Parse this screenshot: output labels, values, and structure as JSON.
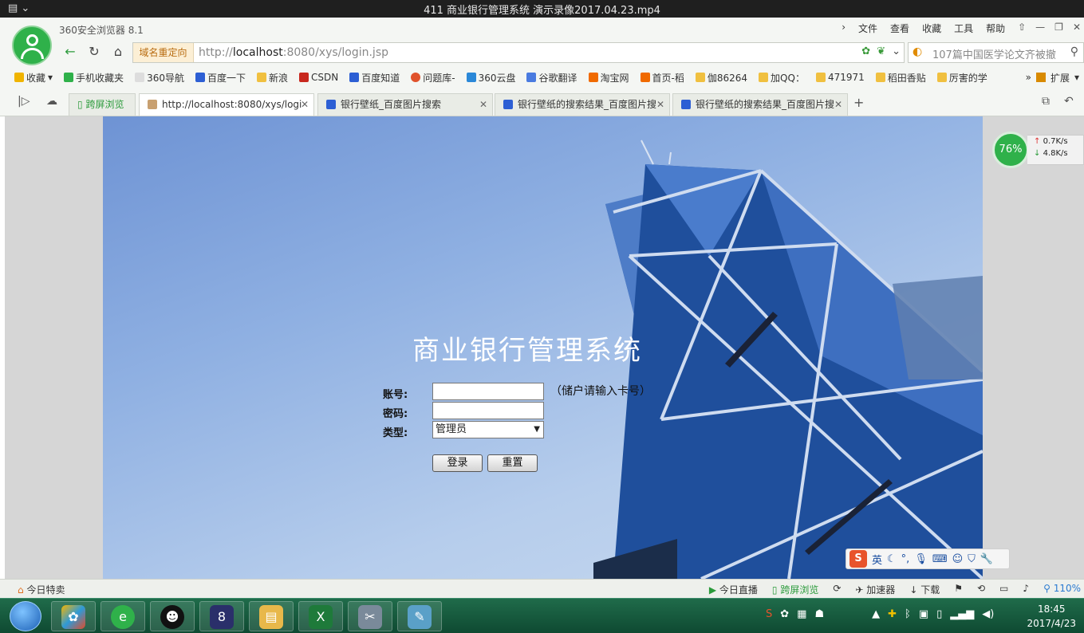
{
  "window": {
    "title": "411 商业银行管理系统  演示录像2017.04.23.mp4"
  },
  "browser": {
    "name": "360安全浏览器 8.1",
    "menu": [
      "文件",
      "查看",
      "收藏",
      "工具",
      "帮助"
    ],
    "redirect_label": "域名重定向",
    "url_prefix": "http://",
    "url_host": "localhost",
    "url_rest": ":8080/xys/login.jsp",
    "search_placeholder": "107篇中国医学论文齐被撤",
    "bookmarks": [
      "收藏",
      "手机收藏夹",
      "360导航",
      "百度一下",
      "新浪",
      "CSDN",
      "百度知道",
      "问题库-",
      "360云盘",
      "谷歌翻译",
      "淘宝网",
      "首页-稻",
      "伽86264",
      "加QQ：",
      "471971",
      "稻田香贴",
      "厉害的学"
    ],
    "bookmark_extend": "扩展",
    "tabs": [
      {
        "label": "跨屏浏览"
      },
      {
        "label": "http://localhost:8080/xys/logi"
      },
      {
        "label": "银行壁纸_百度图片搜索"
      },
      {
        "label": "银行壁纸的搜索结果_百度图片搜"
      },
      {
        "label": "银行壁纸的搜索结果_百度图片搜"
      }
    ]
  },
  "page": {
    "title": "商业银行管理系统",
    "account_label": "账号:",
    "account_value": "",
    "account_hint": "（储户请输入卡号）",
    "password_label": "密码:",
    "type_label": "类型:",
    "type_selected": "管理员",
    "login_button": "登录",
    "reset_button": "重置"
  },
  "speed_widget": {
    "percent": "76%",
    "up": "0.7K/s",
    "down": "4.8K/s"
  },
  "ime": {
    "mode": "英"
  },
  "statusbar": {
    "left": "今日特卖",
    "items": [
      "今日直播",
      "跨屏浏览",
      "加速器",
      "下载"
    ],
    "zoom": "110%"
  },
  "taskbar": {
    "time": "18:45",
    "date": "2017/4/23"
  }
}
